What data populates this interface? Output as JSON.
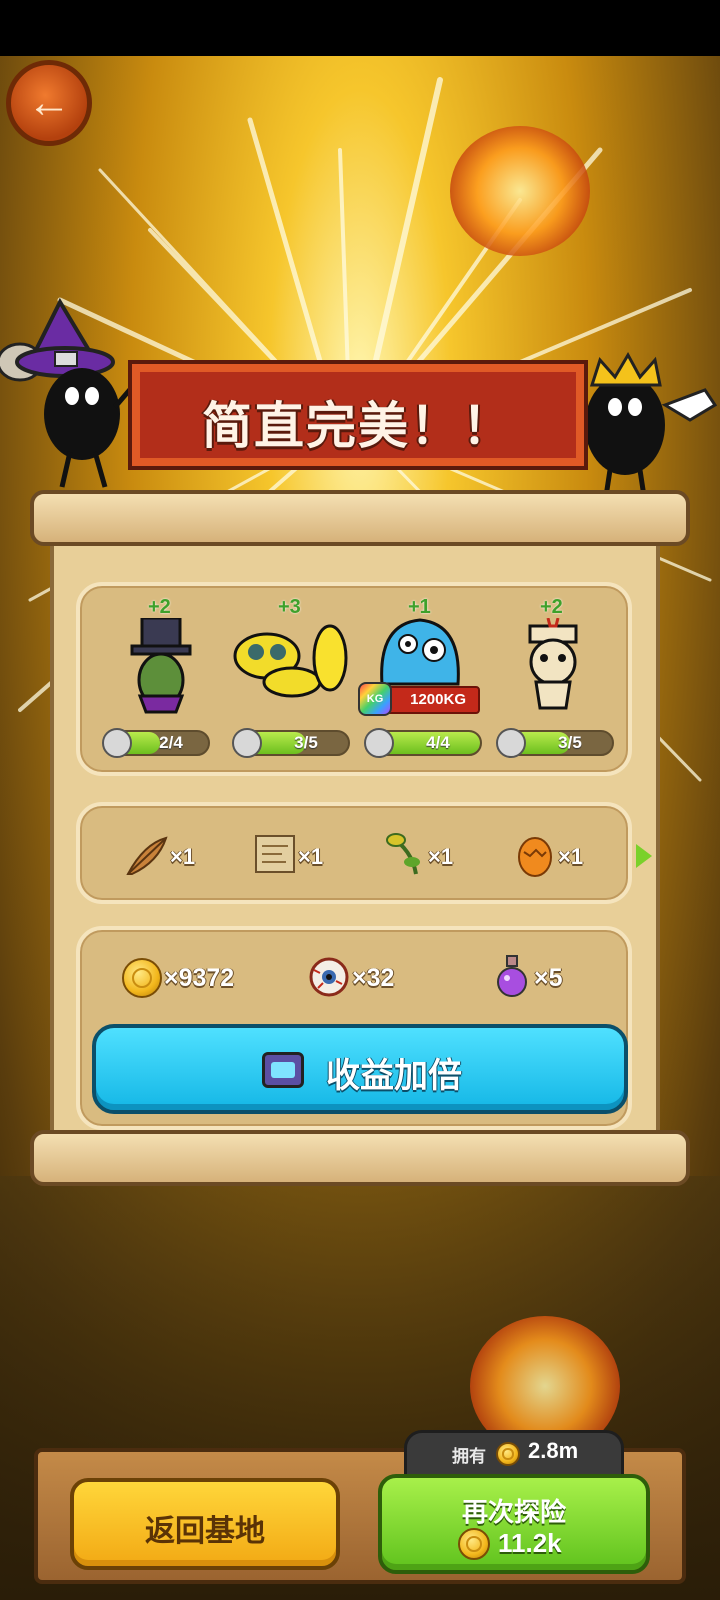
{
  "banner": {
    "title": "简直完美！！"
  },
  "monsters": [
    {
      "plus": "+2",
      "progress": "2/4",
      "fill": 0.5
    },
    {
      "plus": "+3",
      "progress": "3/5",
      "fill": 0.6
    },
    {
      "plus": "+1",
      "progress": "4/4",
      "fill": 1.0,
      "weight": "1200KG",
      "weight_badge": "KG"
    },
    {
      "plus": "+2",
      "progress": "3/5",
      "fill": 0.6
    }
  ],
  "items": [
    {
      "icon": "feather-icon",
      "qty": "×1"
    },
    {
      "icon": "map-scroll-icon",
      "qty": "×1"
    },
    {
      "icon": "herb-icon",
      "qty": "×1"
    },
    {
      "icon": "egg-icon",
      "qty": "×1"
    }
  ],
  "resources": [
    {
      "icon": "gold-coin-icon",
      "qty": "×9372"
    },
    {
      "icon": "eyeball-icon",
      "qty": "×32"
    },
    {
      "icon": "potion-icon",
      "qty": "×5"
    }
  ],
  "double_button": {
    "label": "收益加倍"
  },
  "bottom": {
    "return_label": "返回基地",
    "own_label": "拥有",
    "own_value": "2.8m",
    "explore_label": "再次探险",
    "explore_cost": "11.2k"
  },
  "colors": {
    "banner": "#b22e1a",
    "double_button": "#14b7e6",
    "return_button": "#f2a914",
    "explore_button": "#5fc21d"
  }
}
